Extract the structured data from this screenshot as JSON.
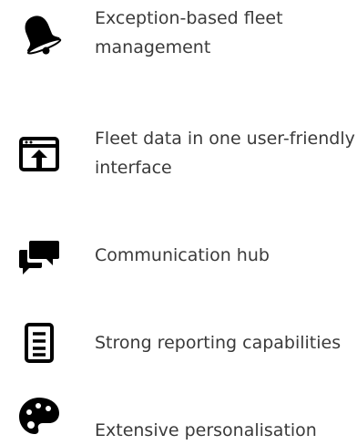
{
  "features": [
    {
      "icon": "bell-icon",
      "label": "Exception-based fleet management"
    },
    {
      "icon": "upload-window-icon",
      "label": "Fleet data in one user-friendly interface"
    },
    {
      "icon": "chat-bubbles-icon",
      "label": "Communication hub"
    },
    {
      "icon": "report-document-icon",
      "label": "Strong reporting capabilities"
    },
    {
      "icon": "palette-icon",
      "label": "Extensive personalisation"
    }
  ],
  "colors": {
    "icon": "#000000",
    "text": "#3a3a3a",
    "background": "#ffffff"
  }
}
